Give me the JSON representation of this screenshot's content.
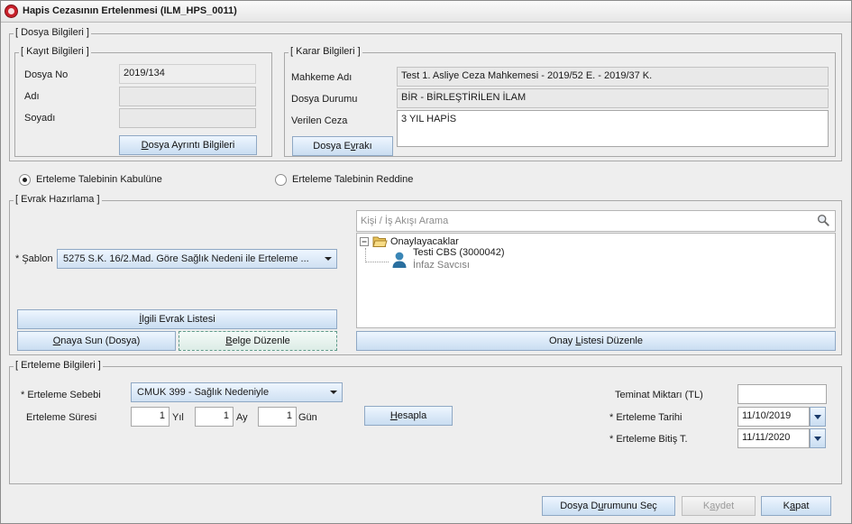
{
  "window": {
    "title": "Hapis Cezasının Ertelenmesi (ILM_HPS_0011)"
  },
  "dosya_bilgileri": {
    "legend": "[ Dosya Bilgileri ]",
    "kayit": {
      "legend": "[ Kayıt Bilgileri ]",
      "dosya_no_label": "Dosya No",
      "dosya_no_value": "2019/134",
      "adi_label": "Adı",
      "adi_value": "",
      "soyadi_label": "Soyadı",
      "soyadi_value": "",
      "ayrinti_button_pre": "D",
      "ayrinti_button_rest": "osya Ayrıntı Bilgileri"
    },
    "karar": {
      "legend": "[ Karar Bilgileri ]",
      "mahkeme_label": "Mahkeme Adı",
      "mahkeme_value": "Test 1. Asliye Ceza Mahkemesi - 2019/52 E. - 2019/37 K.",
      "durum_label": "Dosya Durumu",
      "durum_value": "BİR - BİRLEŞTİRİLEN İLAM",
      "ceza_label": "Verilen Ceza",
      "ceza_value": "3 YIL HAPİS",
      "evraki_button_pre": "Dosya E",
      "evraki_button_u": "v",
      "evraki_button_post": "rakı"
    }
  },
  "radios": {
    "kabul_label": "Erteleme Talebinin Kabulüne",
    "ret_label": "Erteleme Talebinin Reddine",
    "selected": "kabul"
  },
  "evrak": {
    "legend": "[ Evrak Hazırlama ]",
    "sablon_label": "* Şablon",
    "sablon_value": "5275 S.K. 16/2.Mad. Göre Sağlık Nedeni ile Erteleme ...",
    "search_placeholder": "Kişi / İş Akışı Arama",
    "tree": {
      "root_label": "Onaylayacaklar",
      "person_name": "Testi CBS (3000042)",
      "person_role": "İnfaz Savcısı"
    },
    "ilgili_button_pre": "İ",
    "ilgili_button_rest": "lgili Evrak Listesi",
    "onaya_button_pre": "O",
    "onaya_button_rest": "naya Sun (Dosya)",
    "belge_button_pre": "B",
    "belge_button_rest": "elge Düzenle",
    "onay_listesi_button_pre": "Onay ",
    "onay_listesi_button_u": "L",
    "onay_listesi_button_post": "istesi Düzenle"
  },
  "erteleme": {
    "legend": "[ Erteleme Bilgileri ]",
    "sebep_label": "* Erteleme Sebebi",
    "sebep_value": "CMUK 399 - Sağlık Nedeniyle",
    "sure_label": "Erteleme Süresi",
    "yil_value": "1",
    "yil_label": "Yıl",
    "ay_value": "1",
    "ay_label": "Ay",
    "gun_value": "1",
    "gun_label": "Gün",
    "hesapla_button_pre": "H",
    "hesapla_button_rest": "esapla",
    "teminat_label": "Teminat Miktarı (TL)",
    "teminat_value": "",
    "tarih_label": "* Erteleme Tarihi",
    "tarih_value": "11/10/2019",
    "bitis_label": "* Erteleme Bitiş T.",
    "bitis_value": "11/11/2020"
  },
  "footer": {
    "dosya_durumu_pre": "Dosya D",
    "dosya_durumu_u": "u",
    "dosya_durumu_post": "rumunu Seç",
    "kaydet_pre": "K",
    "kaydet_u": "a",
    "kaydet_post": "ydet",
    "kapat_pre": "K",
    "kapat_u": "a",
    "kapat_post": "pat"
  }
}
